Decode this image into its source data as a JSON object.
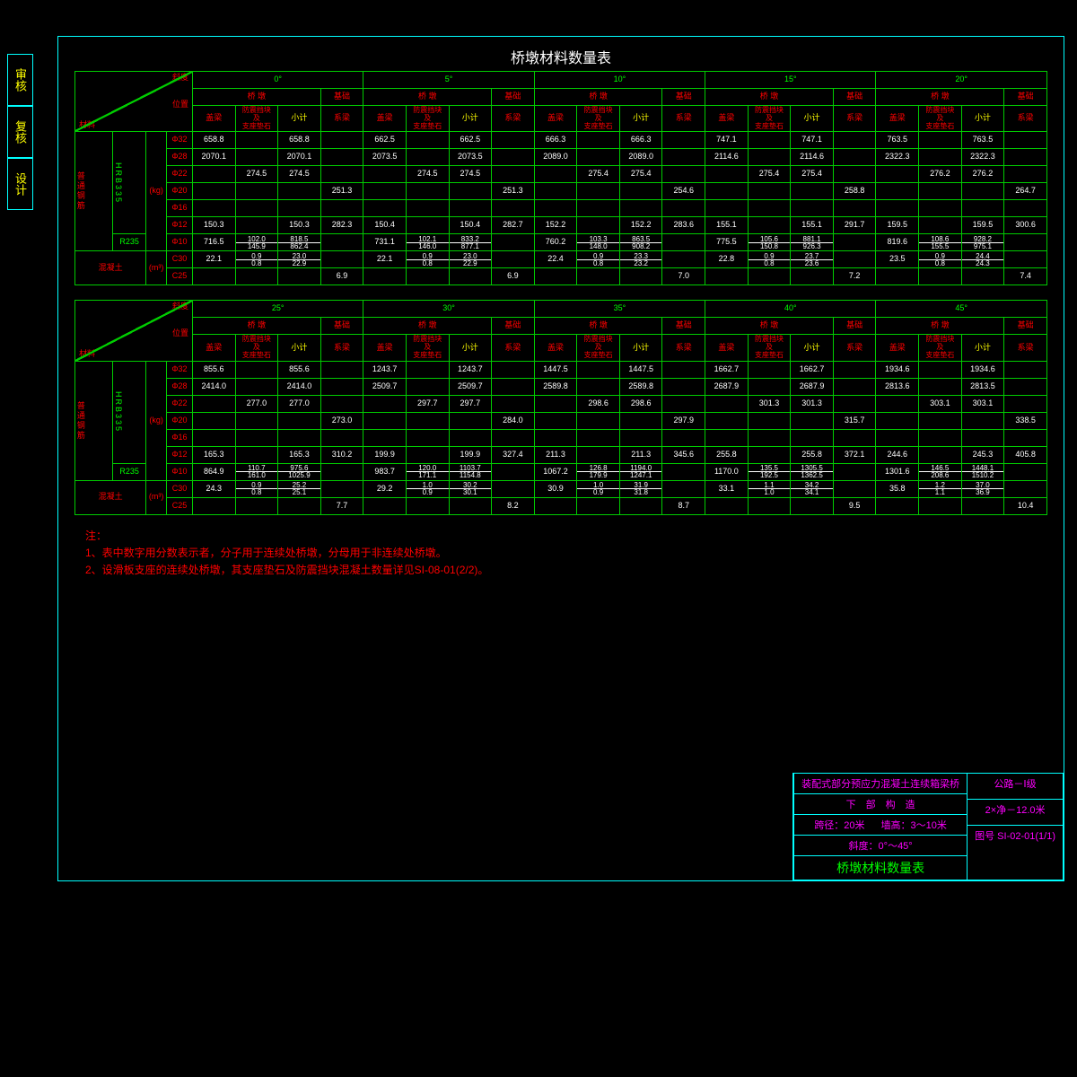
{
  "side": [
    "审核",
    "复核",
    "设计"
  ],
  "main_title": "桥墩材料数量表",
  "hdr": {
    "obliq": "斜度",
    "pos": "位置",
    "mat": "材料",
    "pier": "桥 墩",
    "base": "基础",
    "gl": "盖梁",
    "blk": "防震挡块\n及\n支座垫石",
    "sub": "小计",
    "tie": "系梁"
  },
  "angles_a": [
    "0°",
    "5°",
    "10°",
    "15°",
    "20°"
  ],
  "angles_b": [
    "25°",
    "30°",
    "35°",
    "40°",
    "45°"
  ],
  "rowlabels": {
    "rebar": "普通钢筋",
    "grade1": "HRB335",
    "grade2": "R235",
    "unit": "(kg)",
    "conc": "混凝土",
    "cunit": "(m³)",
    "d32": "Φ32",
    "d28": "Φ28",
    "d22": "Φ22",
    "d20": "Φ20",
    "d16": "Φ16",
    "d12": "Φ12",
    "d10": "Φ10",
    "c30": "C30",
    "c25": "C25"
  },
  "chart_data": {
    "type": "table",
    "title": "桥墩材料数量表",
    "table_a": {
      "angles": [
        "0°",
        "5°",
        "10°",
        "15°",
        "20°"
      ],
      "rows": [
        {
          "label": "Φ32",
          "cells": [
            "658.8",
            "",
            "658.8",
            "",
            "662.5",
            "",
            "662.5",
            "",
            "666.3",
            "",
            "666.3",
            "",
            "747.1",
            "",
            "747.1",
            "",
            "763.5",
            "",
            "763.5",
            ""
          ]
        },
        {
          "label": "Φ28",
          "cells": [
            "2070.1",
            "",
            "2070.1",
            "",
            "2073.5",
            "",
            "2073.5",
            "",
            "2089.0",
            "",
            "2089.0",
            "",
            "2114.6",
            "",
            "2114.6",
            "",
            "2322.3",
            "",
            "2322.3",
            ""
          ]
        },
        {
          "label": "Φ22",
          "cells": [
            "",
            "274.5",
            "274.5",
            "",
            "",
            "274.5",
            "274.5",
            "",
            "",
            "275.4",
            "275.4",
            "",
            "",
            "275.4",
            "275.4",
            "",
            "",
            "276.2",
            "276.2",
            ""
          ]
        },
        {
          "label": "Φ20",
          "cells": [
            "",
            "",
            "",
            "251.3",
            "",
            "",
            "",
            "251.3",
            "",
            "",
            "",
            "254.6",
            "",
            "",
            "",
            "258.8",
            "",
            "",
            "",
            "264.7"
          ]
        },
        {
          "label": "Φ16",
          "cells": [
            "",
            "",
            "",
            "",
            "",
            "",
            "",
            "",
            "",
            "",
            "",
            "",
            "",
            "",
            "",
            "",
            "",
            "",
            "",
            ""
          ]
        },
        {
          "label": "Φ12",
          "cells": [
            "150.3",
            "",
            "150.3",
            "282.3",
            "150.4",
            "",
            "150.4",
            "282.7",
            "152.2",
            "",
            "152.2",
            "283.6",
            "155.1",
            "",
            "155.1",
            "291.7",
            "159.5",
            "",
            "159.5",
            "300.6"
          ]
        },
        {
          "label": "Φ10",
          "cells": [
            "716.5",
            "102.0/145.9",
            "818.5/862.4",
            "",
            "731.1",
            "102.1/146.0",
            "833.2/877.1",
            "",
            "760.2",
            "103.3/148.0",
            "863.5/908.2",
            "",
            "775.5",
            "105.6/150.8",
            "881.1/926.3",
            "",
            "819.6",
            "108.6/155.5",
            "928.2/975.1",
            ""
          ]
        },
        {
          "label": "C30",
          "cells": [
            "22.1",
            "0.9/0.8",
            "23.0/22.9",
            "",
            "22.1",
            "0.9/0.8",
            "23.0/22.9",
            "",
            "22.4",
            "0.9/0.8",
            "23.3/23.2",
            "",
            "22.8",
            "0.9/0.8",
            "23.7/23.6",
            "",
            "23.5",
            "0.9/0.8",
            "24.4/24.3",
            ""
          ]
        },
        {
          "label": "C25",
          "cells": [
            "",
            "",
            "",
            "6.9",
            "",
            "",
            "",
            "6.9",
            "",
            "",
            "",
            "7.0",
            "",
            "",
            "",
            "7.2",
            "",
            "",
            "",
            "7.4"
          ]
        }
      ]
    },
    "table_b": {
      "angles": [
        "25°",
        "30°",
        "35°",
        "40°",
        "45°"
      ],
      "rows": [
        {
          "label": "Φ32",
          "cells": [
            "855.6",
            "",
            "855.6",
            "",
            "1243.7",
            "",
            "1243.7",
            "",
            "1447.5",
            "",
            "1447.5",
            "",
            "1662.7",
            "",
            "1662.7",
            "",
            "1934.6",
            "",
            "1934.6",
            ""
          ]
        },
        {
          "label": "Φ28",
          "cells": [
            "2414.0",
            "",
            "2414.0",
            "",
            "2509.7",
            "",
            "2509.7",
            "",
            "2589.8",
            "",
            "2589.8",
            "",
            "2687.9",
            "",
            "2687.9",
            "",
            "2813.6",
            "",
            "2813.5",
            ""
          ]
        },
        {
          "label": "Φ22",
          "cells": [
            "",
            "277.0",
            "277.0",
            "",
            "",
            "297.7",
            "297.7",
            "",
            "",
            "298.6",
            "298.6",
            "",
            "",
            "301.3",
            "301.3",
            "",
            "",
            "303.1",
            "303.1",
            ""
          ]
        },
        {
          "label": "Φ20",
          "cells": [
            "",
            "",
            "",
            "273.0",
            "",
            "",
            "",
            "284.0",
            "",
            "",
            "",
            "297.9",
            "",
            "",
            "",
            "315.7",
            "",
            "",
            "",
            "338.5"
          ]
        },
        {
          "label": "Φ16",
          "cells": [
            "",
            "",
            "",
            "",
            "",
            "",
            "",
            "",
            "",
            "",
            "",
            "",
            "",
            "",
            "",
            "",
            "",
            "",
            "",
            ""
          ]
        },
        {
          "label": "Φ12",
          "cells": [
            "165.3",
            "",
            "165.3",
            "310.2",
            "199.9",
            "",
            "199.9",
            "327.4",
            "211.3",
            "",
            "211.3",
            "345.6",
            "255.8",
            "",
            "255.8",
            "372.1",
            "244.6",
            "",
            "245.3",
            "405.8"
          ]
        },
        {
          "label": "Φ10",
          "cells": [
            "864.9",
            "110.7/161.0",
            "975.6/1025.9",
            "",
            "983.7",
            "120.0/171.1",
            "1103.7/1154.8",
            "",
            "1067.2",
            "126.8/179.9",
            "1194.0/1247.1",
            "",
            "1170.0",
            "135.5/192.5",
            "1305.5/1362.5",
            "",
            "1301.6",
            "146.5/208.6",
            "1448.1/1510.2",
            ""
          ]
        },
        {
          "label": "C30",
          "cells": [
            "24.3",
            "0.9/0.8",
            "25.2/25.1",
            "",
            "29.2",
            "1.0/0.9",
            "30.2/30.1",
            "",
            "30.9",
            "1.0/0.9",
            "31.9/31.8",
            "",
            "33.1",
            "1.1/1.0",
            "34.2/34.1",
            "",
            "35.8",
            "1.2/1.1",
            "37.0/36.9",
            ""
          ]
        },
        {
          "label": "C25",
          "cells": [
            "",
            "",
            "",
            "7.7",
            "",
            "",
            "",
            "8.2",
            "",
            "",
            "",
            "8.7",
            "",
            "",
            "",
            "9.5",
            "",
            "",
            "",
            "10.4"
          ]
        }
      ]
    }
  },
  "notes": {
    "head": "注：",
    "n1": "1、表中数字用分数表示者，分子用于连续处桥墩，分母用于非连续处桥墩。",
    "n2": "2、设滑板支座的连续处桥墩，其支座垫石及防震挡块混凝土数量详见SI-08-01(2/2)。"
  },
  "tb": {
    "l1": "装配式部分预应力混凝土连续箱梁桥",
    "l2": "下　部　构　造",
    "l3a": "跨径：20米",
    "l3b": "墙高：3～10米",
    "l4a": "斜度：0°～45°",
    "t2": "桥墩材料数量表",
    "r1": "公路－Ⅰ级",
    "r2": "2×净－12.0米",
    "r3": "图号 SI-02-01(1/1)"
  }
}
